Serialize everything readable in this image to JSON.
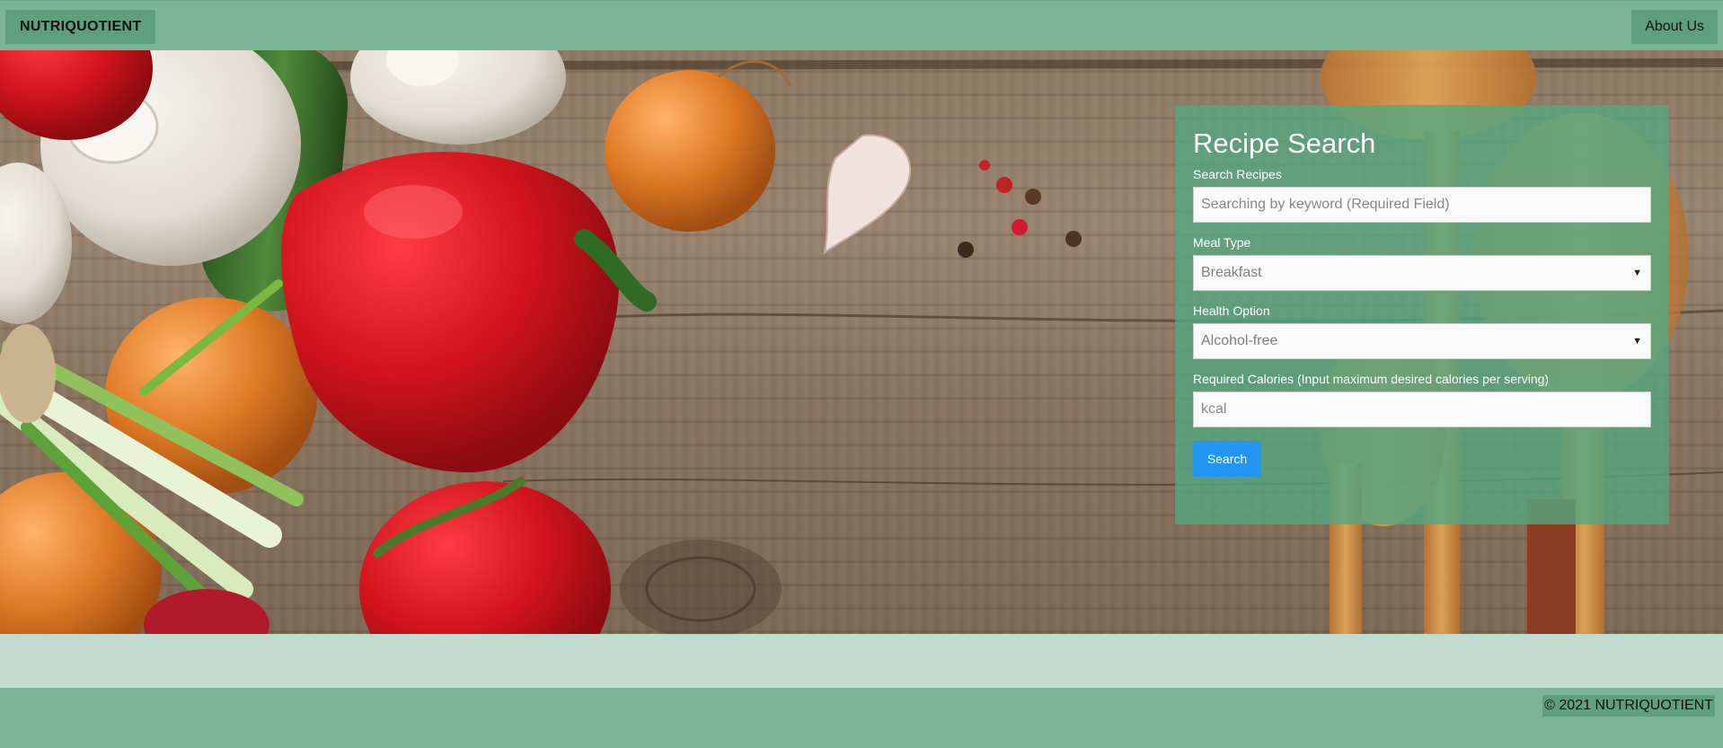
{
  "navbar": {
    "brand": "NUTRIQUOTIENT",
    "about_label": "About Us"
  },
  "search_panel": {
    "title": "Recipe Search",
    "keyword": {
      "label": "Search Recipes",
      "placeholder": "Searching by keyword (Required Field)"
    },
    "meal_type": {
      "label": "Meal Type",
      "selected": "Breakfast"
    },
    "health_option": {
      "label": "Health Option",
      "selected": "Alcohol-free"
    },
    "calories": {
      "label": "Required Calories (Input maximum desired calories per serving)",
      "placeholder": "kcal"
    },
    "search_label": "Search"
  },
  "footer": {
    "copyright": "© 2021 NUTRIQUOTIENT"
  },
  "colors": {
    "nav_green": "#7ab598",
    "panel_green": "#54a87f",
    "button_blue": "#2196f3",
    "strip_green": "#c1dccf"
  },
  "icons": {
    "select_arrow": "dropdown-arrow-icon"
  }
}
